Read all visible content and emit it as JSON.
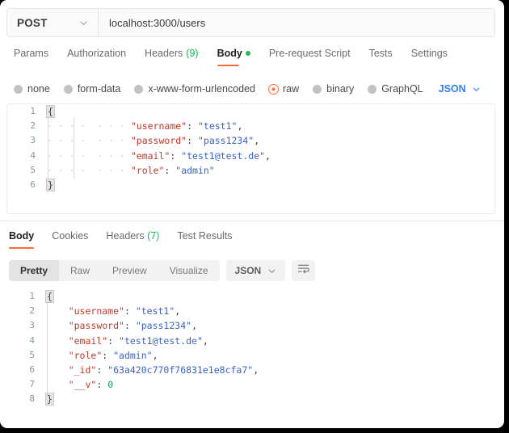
{
  "request": {
    "method": "POST",
    "url": "localhost:3000/users",
    "tabs": [
      {
        "label": "Params",
        "active": false
      },
      {
        "label": "Authorization",
        "active": false
      },
      {
        "label": "Headers",
        "count": "(9)",
        "active": false
      },
      {
        "label": "Body",
        "active": true,
        "dot": true
      },
      {
        "label": "Pre-request Script",
        "active": false
      },
      {
        "label": "Tests",
        "active": false
      },
      {
        "label": "Settings",
        "active": false
      }
    ],
    "body_types": [
      {
        "label": "none",
        "selected": false
      },
      {
        "label": "form-data",
        "selected": false
      },
      {
        "label": "x-www-form-urlencoded",
        "selected": false
      },
      {
        "label": "raw",
        "selected": true
      },
      {
        "label": "binary",
        "selected": false
      },
      {
        "label": "GraphQL",
        "selected": false
      }
    ],
    "format": "JSON",
    "body_lines": [
      {
        "n": "1",
        "type": "open"
      },
      {
        "n": "2",
        "type": "kv",
        "key": "\"username\"",
        "val": "\"test1\"",
        "comma": ","
      },
      {
        "n": "3",
        "type": "kv",
        "key": "\"password\"",
        "val": "\"pass1234\"",
        "comma": ","
      },
      {
        "n": "4",
        "type": "kv",
        "key": "\"email\"",
        "val": "\"test1@test.de\"",
        "comma": ","
      },
      {
        "n": "5",
        "type": "kv",
        "key": "\"role\"",
        "val": "\"admin\"",
        "comma": ""
      },
      {
        "n": "6",
        "type": "close"
      }
    ],
    "open_brace": "{",
    "close_brace": "}"
  },
  "response": {
    "tabs": [
      {
        "label": "Body",
        "active": true
      },
      {
        "label": "Cookies",
        "active": false
      },
      {
        "label": "Headers",
        "count": "(7)",
        "active": false
      },
      {
        "label": "Test Results",
        "active": false
      }
    ],
    "views": [
      {
        "label": "Pretty",
        "active": true
      },
      {
        "label": "Raw",
        "active": false
      },
      {
        "label": "Preview",
        "active": false
      },
      {
        "label": "Visualize",
        "active": false
      }
    ],
    "format": "JSON",
    "body_lines": [
      {
        "n": "1",
        "type": "open"
      },
      {
        "n": "2",
        "type": "kv",
        "key": "\"username\"",
        "val": "\"test1\"",
        "comma": ",",
        "numeric": false
      },
      {
        "n": "3",
        "type": "kv",
        "key": "\"password\"",
        "val": "\"pass1234\"",
        "comma": ",",
        "numeric": false
      },
      {
        "n": "4",
        "type": "kv",
        "key": "\"email\"",
        "val": "\"test1@test.de\"",
        "comma": ",",
        "numeric": false
      },
      {
        "n": "5",
        "type": "kv",
        "key": "\"role\"",
        "val": "\"admin\"",
        "comma": ",",
        "numeric": false
      },
      {
        "n": "6",
        "type": "kv",
        "key": "\"_id\"",
        "val": "\"63a420c770f76831e1e8cfa7\"",
        "comma": ",",
        "numeric": false
      },
      {
        "n": "7",
        "type": "kv",
        "key": "\"__v\"",
        "val": "0",
        "comma": "",
        "numeric": true
      },
      {
        "n": "8",
        "type": "close"
      }
    ],
    "open_brace": "{",
    "close_brace": "}"
  },
  "colors": {
    "accent": "#ff6c37",
    "green": "#28bb4b",
    "link": "#2d7ff9",
    "key": "#c0392b",
    "string": "#3b62c4",
    "number": "#1a9c52"
  },
  "punct": {
    "colon": ":",
    "space": " "
  }
}
